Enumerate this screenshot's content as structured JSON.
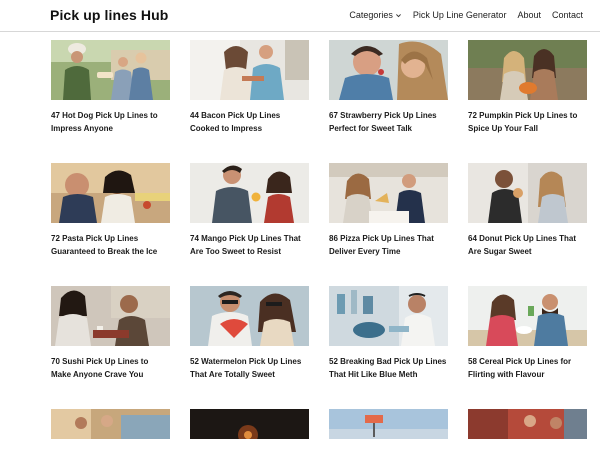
{
  "header": {
    "site_title": "Pick up lines Hub",
    "nav": [
      {
        "label": "Categories",
        "has_dropdown": true
      },
      {
        "label": "Pick Up Line Generator"
      },
      {
        "label": "About"
      },
      {
        "label": "Contact"
      }
    ]
  },
  "posts": [
    {
      "title": "47 Hot Dog Pick Up Lines to Impress Anyone"
    },
    {
      "title": "44 Bacon Pick Up Lines Cooked to Impress"
    },
    {
      "title": "67 Strawberry Pick Up Lines Perfect for Sweet Talk"
    },
    {
      "title": "72 Pumpkin Pick Up Lines to Spice Up Your Fall"
    },
    {
      "title": "72 Pasta Pick Up Lines Guaranteed to Break the Ice"
    },
    {
      "title": "74 Mango Pick Up Lines That Are Too Sweet to Resist"
    },
    {
      "title": "86 Pizza Pick Up Lines That Deliver Every Time"
    },
    {
      "title": "64 Donut Pick Up Lines That Are Sugar Sweet"
    },
    {
      "title": "70 Sushi Pick Up Lines to Make Anyone Crave You"
    },
    {
      "title": "52 Watermelon Pick Up Lines That Are Totally Sweet"
    },
    {
      "title": "52 Breaking Bad Pick Up Lines That Hit Like Blue Meth"
    },
    {
      "title": "58 Cereal Pick Up Lines for Flirting with Flavour"
    }
  ]
}
